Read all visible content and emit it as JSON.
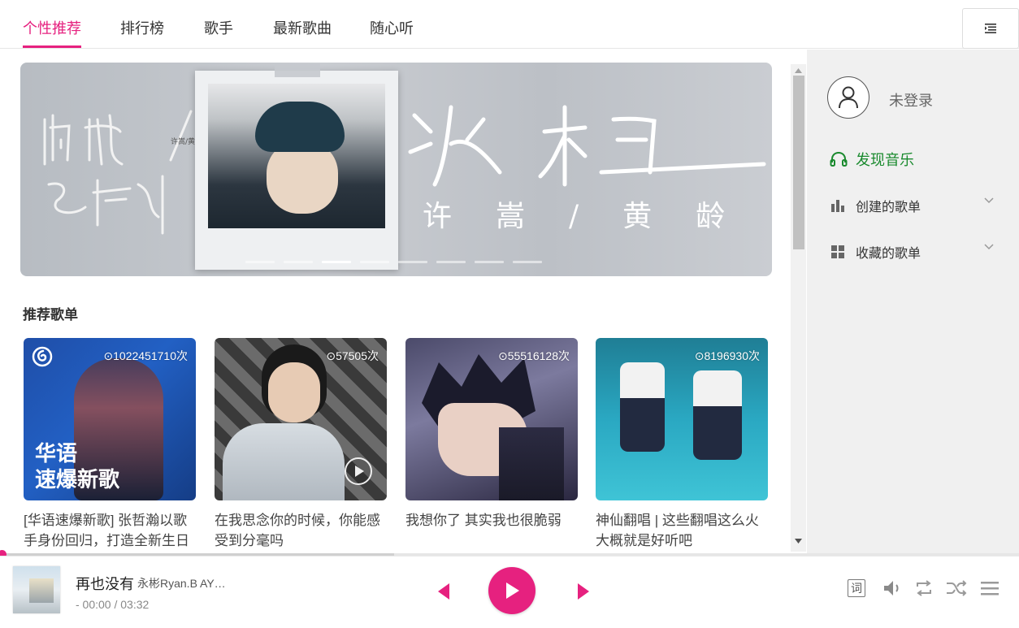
{
  "nav": {
    "tabs": [
      "个性推荐",
      "排行榜",
      "歌手",
      "最新歌曲",
      "随心听"
    ],
    "active_tab": "个性推荐",
    "menu_icon": "menu-list-icon"
  },
  "banner": {
    "left_title": "呼吸之野",
    "title": "冰柜",
    "artists": "许嵩/黄龄",
    "dots_count": 8,
    "active_dot": 2
  },
  "recommend": {
    "title": "推荐歌单",
    "playlists": [
      {
        "plays": "1022451710次",
        "title": "[华语速爆新歌] 张哲瀚以歌手身份回归，打造全新生日",
        "cover_text": "华语\n速爆新歌"
      },
      {
        "plays": "57505次",
        "title": "在我思念你的时候，你能感受到分毫吗"
      },
      {
        "plays": "55516128次",
        "title": "我想你了 其实我也很脆弱"
      },
      {
        "plays": "8196930次",
        "title": "神仙翻唱 | 这些翻唱这么火大概就是好听吧"
      }
    ]
  },
  "sidebar": {
    "login": "未登录",
    "discover": "发现音乐",
    "created": "创建的歌单",
    "collected": "收藏的歌单"
  },
  "player": {
    "song": "再也没有",
    "artist": "永彬Ryan.B AY…",
    "time": "- 00:00 / 03:32",
    "lyric_label": "词",
    "progress": 0.0,
    "accent": "#e6217f"
  }
}
